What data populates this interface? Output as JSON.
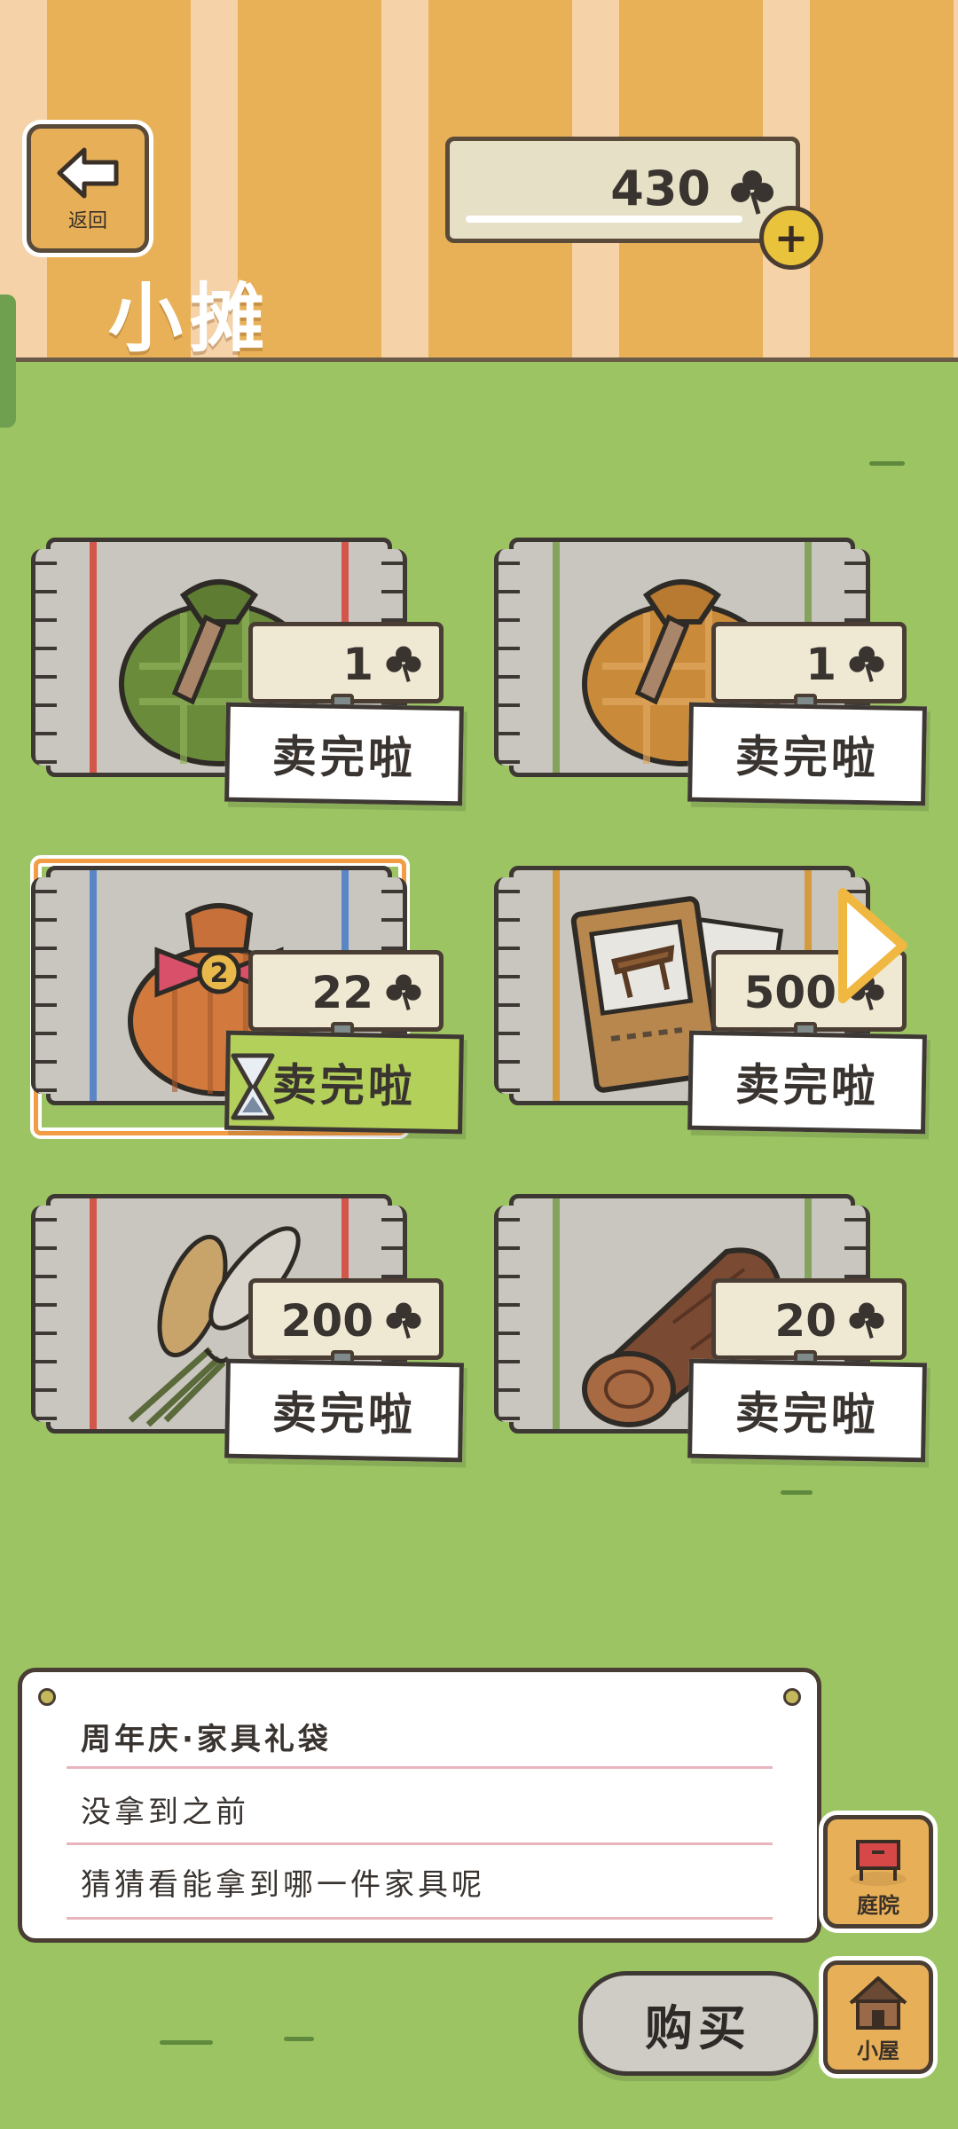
{
  "header": {
    "back_label": "返回",
    "title": "小摊",
    "currency_value": "430",
    "currency_icon": "clover-icon"
  },
  "items": [
    {
      "price": "1",
      "status": "卖完啦",
      "picture": "green-furoshiki-bag-icon",
      "stripe_color": "#d2574a"
    },
    {
      "price": "1",
      "status": "卖完啦",
      "picture": "orange-furoshiki-bag-icon",
      "stripe_color": "#86a35e"
    },
    {
      "price": "22",
      "status": "卖完啦",
      "picture": "anniversary-gift-bag-icon",
      "stripe_color": "#5a86c8"
    },
    {
      "price": "500",
      "status": "卖完啦",
      "picture": "furniture-catalog-icon",
      "stripe_color": "#d39a3e"
    },
    {
      "price": "200",
      "status": "卖完啦",
      "picture": "pampas-grass-bundle-icon",
      "stripe_color": "#d2574a"
    },
    {
      "price": "20",
      "status": "卖完啦",
      "picture": "wood-log-icon",
      "stripe_color": "#86a35e"
    }
  ],
  "description": {
    "title": "周年庆·家具礼袋",
    "line1": "没拿到之前",
    "line2": "猜猜看能拿到哪一件家具呢"
  },
  "buttons": {
    "yard": "庭院",
    "house": "小屋",
    "buy": "购买"
  },
  "colors": {
    "grass": "#9cc463",
    "stripe_light": "#f5d2a8",
    "stripe_dark": "#e9b157",
    "selected_frame": "#f39c46",
    "sold_selected": "#b2d05a"
  }
}
